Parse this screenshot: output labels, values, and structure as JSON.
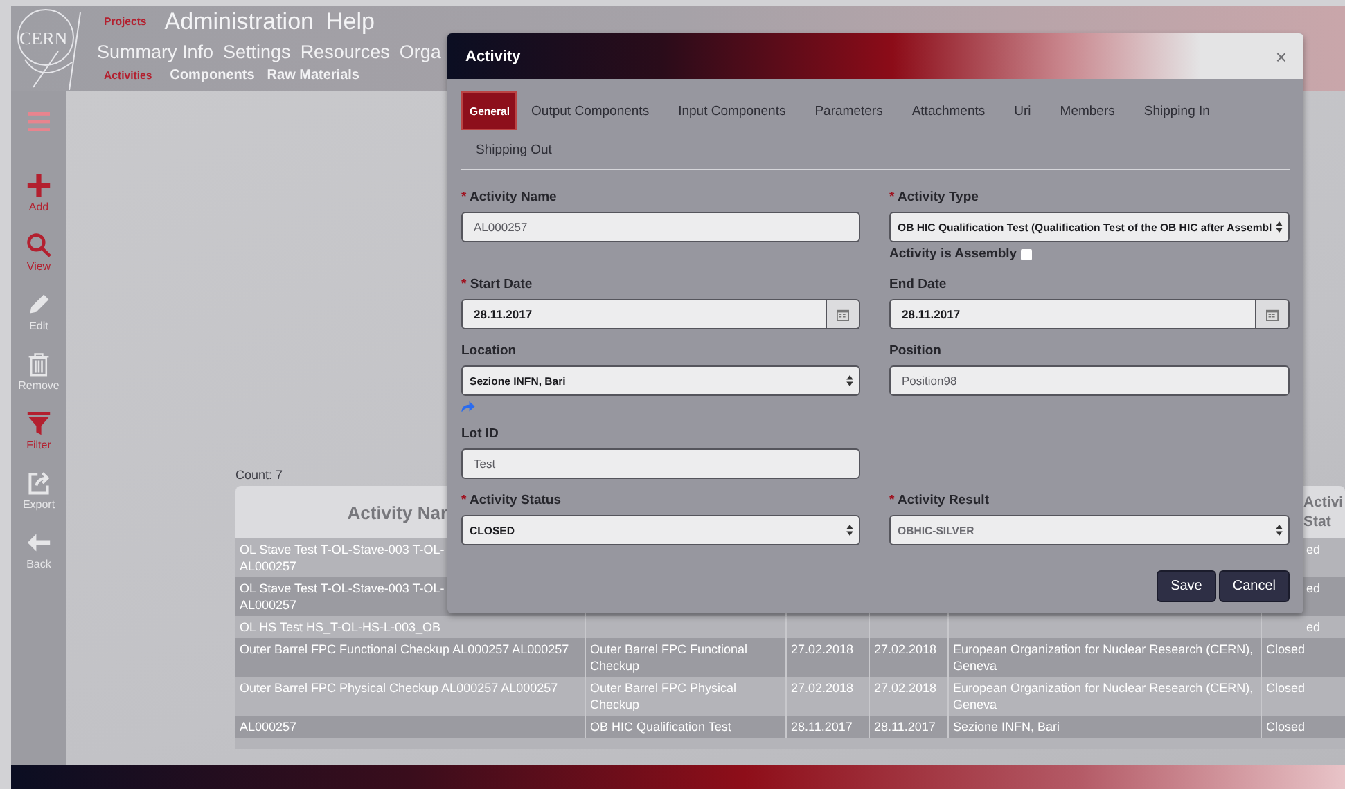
{
  "header": {
    "logo": "CERN",
    "nav_primary": [
      {
        "label": "Projects",
        "selected": true
      },
      {
        "label": "Administration",
        "selected": false
      },
      {
        "label": "Help",
        "selected": false
      }
    ],
    "nav_secondary": [
      {
        "label": "Summary Info"
      },
      {
        "label": "Settings"
      },
      {
        "label": "Resources"
      },
      {
        "label": "Orga"
      }
    ],
    "nav_tertiary": [
      {
        "label": "Activities",
        "selected": true
      },
      {
        "label": "Components",
        "selected": false
      },
      {
        "label": "Raw Materials",
        "selected": false
      }
    ]
  },
  "sidebar": {
    "items": [
      {
        "label": "Add",
        "highlighted": true
      },
      {
        "label": "View",
        "highlighted": true
      },
      {
        "label": "Edit",
        "highlighted": false
      },
      {
        "label": "Remove",
        "highlighted": false
      },
      {
        "label": "Filter",
        "highlighted": true
      },
      {
        "label": "Export",
        "highlighted": false
      },
      {
        "label": "Back",
        "highlighted": false
      }
    ]
  },
  "list": {
    "count": "Count: 7",
    "columns": {
      "name": "Activity Nar",
      "status": "Activi Stat"
    },
    "rows": [
      {
        "name": "OL Stave Test T-OL-Stave-003 T-OL- AL000257",
        "status": "ed"
      },
      {
        "name": "OL Stave Test T-OL-Stave-003 T-OL- AL000257",
        "status": "ed"
      },
      {
        "name": "OL HS Test HS_T-OL-HS-L-003_OB",
        "status": "ed"
      },
      {
        "name": "Outer Barrel FPC Functional Checkup AL000257 AL000257",
        "type": "Outer Barrel FPC Functional Checkup",
        "start": "27.02.2018",
        "end": "27.02.2018",
        "location": "European Organization for Nuclear Research (CERN), Geneva",
        "status": "Closed"
      },
      {
        "name": "Outer Barrel FPC Physical Checkup AL000257 AL000257",
        "type": "Outer Barrel FPC Physical Checkup",
        "start": "27.02.2018",
        "end": "27.02.2018",
        "location": "European Organization for Nuclear Research (CERN), Geneva",
        "status": "Closed"
      },
      {
        "name": "AL000257",
        "type": "OB HIC Qualification Test",
        "start": "28.11.2017",
        "end": "28.11.2017",
        "location": "Sezione INFN, Bari",
        "status": "Closed"
      }
    ]
  },
  "modal": {
    "title": "Activity",
    "close": "×",
    "tabs": [
      {
        "label": "General",
        "selected": true
      },
      {
        "label": "Output Components",
        "selected": false
      },
      {
        "label": "Input Components",
        "selected": false
      },
      {
        "label": "Parameters",
        "selected": false
      },
      {
        "label": "Attachments",
        "selected": false
      },
      {
        "label": "Uri",
        "selected": false
      },
      {
        "label": "Members",
        "selected": false
      },
      {
        "label": "Shipping In",
        "selected": false
      },
      {
        "label": "Shipping Out",
        "selected": false
      }
    ],
    "form_rows": [
      [
        {
          "label": "Activity Name",
          "required_mark": "*",
          "kind": "text",
          "value": "AL000257"
        },
        {
          "label": "Activity Type",
          "required_mark": "*",
          "kind": "select",
          "value": "OB HIC Qualification Test (Qualification Test of the OB HIC after Assembl",
          "disabled": false,
          "checkbox": {
            "label": "Activity is Assembly",
            "checked": false
          }
        }
      ],
      [
        {
          "label": "Start Date",
          "required_mark": "*",
          "kind": "date",
          "value": "28.11.2017"
        },
        {
          "label": "End Date",
          "kind": "date",
          "value": "28.11.2017"
        }
      ],
      [
        {
          "label": "Location",
          "kind": "select",
          "value": "Sezione INFN, Bari",
          "disabled": false,
          "link": true
        },
        {
          "label": "Position",
          "kind": "text",
          "value": "Position98"
        }
      ],
      [
        {
          "label": "Lot ID",
          "kind": "text",
          "value": "Test"
        }
      ],
      [
        {
          "label": "Activity Status",
          "required_mark": "*",
          "kind": "select",
          "value": "CLOSED",
          "disabled": false
        },
        {
          "label": "Activity Result",
          "required_mark": "*",
          "kind": "select",
          "value": "OBHIC-SILVER",
          "disabled": true
        }
      ]
    ],
    "buttons": [
      {
        "label": "Save"
      },
      {
        "label": "Cancel"
      }
    ]
  }
}
